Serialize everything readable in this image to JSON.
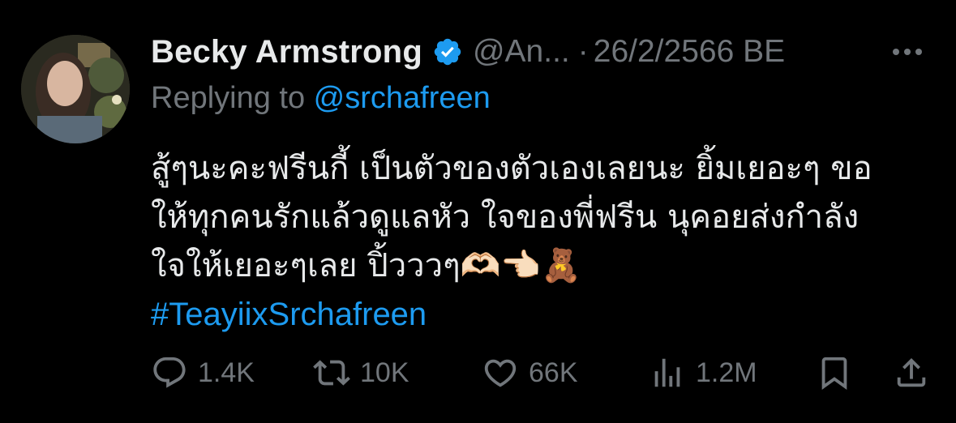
{
  "author": {
    "display_name": "Becky Armstrong",
    "handle": "@An...",
    "separator": "·",
    "date": "26/2/2566 BE",
    "verified_color": "#1d9bf0"
  },
  "reply": {
    "prefix": "Replying to ",
    "mention": "@srchafreen"
  },
  "tweet": {
    "lines": [
      "สู้ๆนะคะฟรีนกี้ เป็นตัวของตัวเองเลยนะ ยิ้มเยอะๆ ขอ",
      "ให้ทุกคนรักแล้วดูแลหัว ใจของพี่ฟรีน นุคอยส่งกำลัง",
      "ใจให้เยอะๆเลย ปิ้วววๆ🫶🏻👈🏻🧸"
    ],
    "hashtag": "#TeayiixSrchafreen"
  },
  "actions": {
    "replies": "1.4K",
    "reposts": "10K",
    "likes": "66K",
    "views": "1.2M"
  },
  "icons": {
    "verified": "verified-badge-icon",
    "more": "more-icon",
    "reply": "reply-icon",
    "repost": "repost-icon",
    "like": "heart-icon",
    "views": "views-icon",
    "bookmark": "bookmark-icon",
    "share": "share-icon"
  },
  "colors": {
    "background": "#000000",
    "text": "#e7e9ea",
    "muted": "#71767b",
    "accent": "#1d9bf0"
  }
}
